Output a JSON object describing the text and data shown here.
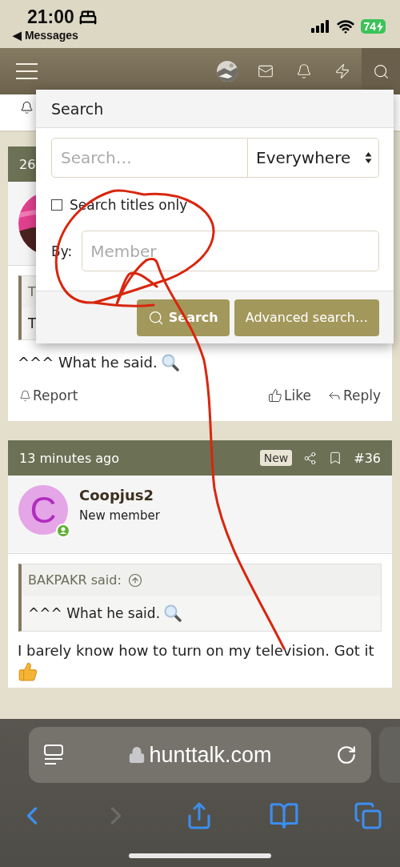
{
  "status_bar": {
    "time": "21:00",
    "back_link": "◀ Messages",
    "battery": "74"
  },
  "search_popup": {
    "title": "Search",
    "query": {
      "placeholder": "Search…"
    },
    "scope": "Everywhere",
    "titles_only": {
      "label": "Search titles only",
      "checked": false
    },
    "by": {
      "label": "By:",
      "placeholder": "Member"
    },
    "buttons": [
      {
        "label": "Search",
        "kind": "primary"
      },
      {
        "label": "Advanced search…",
        "kind": "secondary"
      }
    ]
  },
  "posts": [
    {
      "time": "26",
      "quote": {
        "author": "T",
        "text": "T"
      },
      "body": "^^^ What he said.",
      "actions": [
        "Report",
        "Like",
        "Reply"
      ]
    },
    {
      "time": "13 minutes ago",
      "badge": "New",
      "number": "#36",
      "author": "Coopjus2",
      "author_title": "New member",
      "avatar_letter": "C",
      "quote": {
        "author": "BAKPAKR said:",
        "text": "^^^ What he said."
      },
      "body": "I barely know how to turn on my television. Got it"
    }
  ],
  "browser": {
    "url": "hunttalk.com",
    "forward_disabled": true
  }
}
